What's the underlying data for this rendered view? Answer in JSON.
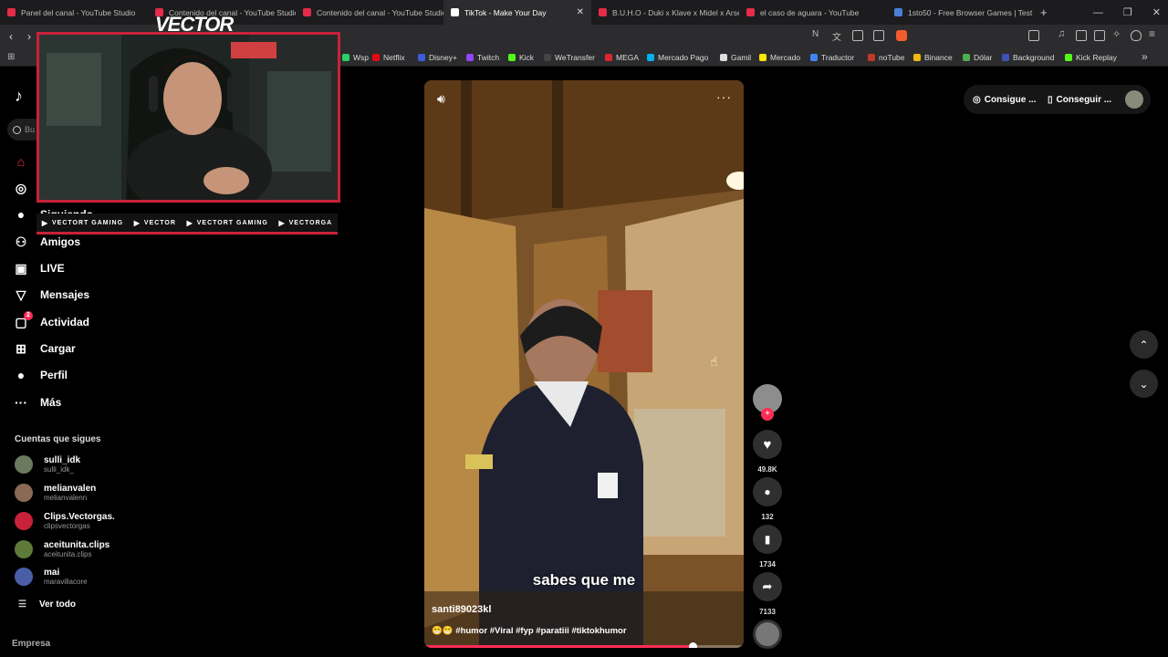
{
  "browser": {
    "tabs": [
      {
        "title": "Panel del canal - YouTube Studio",
        "color": "#e62b4a"
      },
      {
        "title": "Contenido del canal - YouTube Studio",
        "color": "#e62b4a"
      },
      {
        "title": "Contenido del canal - YouTube Studio",
        "color": "#e62b4a"
      },
      {
        "title": "TikTok - Make Your Day",
        "color": "#ffffff",
        "active": true
      },
      {
        "title": "B.U.H.O - Duki x Klave x Midel x Arse",
        "color": "#e62b4a"
      },
      {
        "title": "el caso de aguara - YouTube",
        "color": "#e62b4a"
      },
      {
        "title": "1sto50 - Free Browser Games | Test",
        "color": "#4a7fd6"
      }
    ],
    "new_tab": "+",
    "bookmarks": [
      {
        "label": "Wsp",
        "color": "#25d366"
      },
      {
        "label": "Netflix",
        "color": "#e50914"
      },
      {
        "label": "Disney+",
        "color": "#3b5bdb"
      },
      {
        "label": "Twitch",
        "color": "#9146ff"
      },
      {
        "label": "Kick",
        "color": "#53fc18"
      },
      {
        "label": "WeTransfer",
        "color": "#444444"
      },
      {
        "label": "MEGA",
        "color": "#d9272e"
      },
      {
        "label": "Mercado Pago",
        "color": "#00b1ea"
      },
      {
        "label": "Gamil",
        "color": "#dddddd"
      },
      {
        "label": "Mercado",
        "color": "#ffe600"
      },
      {
        "label": "Traductor",
        "color": "#4285f4"
      },
      {
        "label": "noTube",
        "color": "#c0392b"
      },
      {
        "label": "Binance",
        "color": "#f0b90b"
      },
      {
        "label": "Dólar",
        "color": "#4caf50"
      },
      {
        "label": "Background",
        "color": "#3f51b5"
      },
      {
        "label": "Kick Replay",
        "color": "#53fc18"
      }
    ],
    "more_bookmarks": "»"
  },
  "stream_overlay": {
    "logo_text": "VECTOR",
    "socials": [
      {
        "icon": "youtube-icon",
        "label": "VECTORT GAMING"
      },
      {
        "icon": "twitch-icon",
        "label": "VECTOR"
      },
      {
        "icon": "twitter-icon",
        "label": "VECTORT GAMING"
      },
      {
        "icon": "instagram-icon",
        "label": "VECTORGA"
      }
    ]
  },
  "sidebar": {
    "search_placeholder": "Bu",
    "items": [
      {
        "label": "",
        "icon": "home-icon"
      },
      {
        "label": "",
        "icon": "explore-icon"
      },
      {
        "label": "Siguiendo",
        "icon": "following-icon"
      },
      {
        "label": "Amigos",
        "icon": "friends-icon"
      },
      {
        "label": "LIVE",
        "icon": "live-icon"
      },
      {
        "label": "Mensajes",
        "icon": "messages-icon"
      },
      {
        "label": "Actividad",
        "icon": "activity-icon",
        "badge": "2"
      },
      {
        "label": "Cargar",
        "icon": "upload-icon"
      },
      {
        "label": "Perfil",
        "icon": "profile-icon"
      },
      {
        "label": "Más",
        "icon": "more-icon"
      }
    ],
    "following_title": "Cuentas que sigues",
    "following": [
      {
        "name": "sulli_idk",
        "handle": "sulli_idk_",
        "color": "#6b7a5e"
      },
      {
        "name": "melianvalen",
        "handle": "melianvalenn",
        "color": "#8a6a55"
      },
      {
        "name": "Clips.Vectorgas.",
        "handle": "clipsvectorgas",
        "color": "#c8223a"
      },
      {
        "name": "aceitunita.clips",
        "handle": "aceitunita.clips",
        "color": "#5e7a3a"
      },
      {
        "name": "mai",
        "handle": "maravillacore",
        "color": "#4a5ea8"
      }
    ],
    "see_all": "Ver todo",
    "footer": "Empresa"
  },
  "header": {
    "get_coins": "Consigue ...",
    "get_app": "Conseguir ..."
  },
  "video": {
    "caption": "sabes que me",
    "username": "santi89023kl",
    "tags": "😁😁 #humor #Viral #fyp #paratiii #tiktokhumor",
    "progress": 0.84
  },
  "actions": {
    "likes": "49.8K",
    "comments": "132",
    "saves": "1734",
    "shares": "7133"
  },
  "colors": {
    "accent": "#fe2c55",
    "overlay_red": "#c8223a"
  }
}
